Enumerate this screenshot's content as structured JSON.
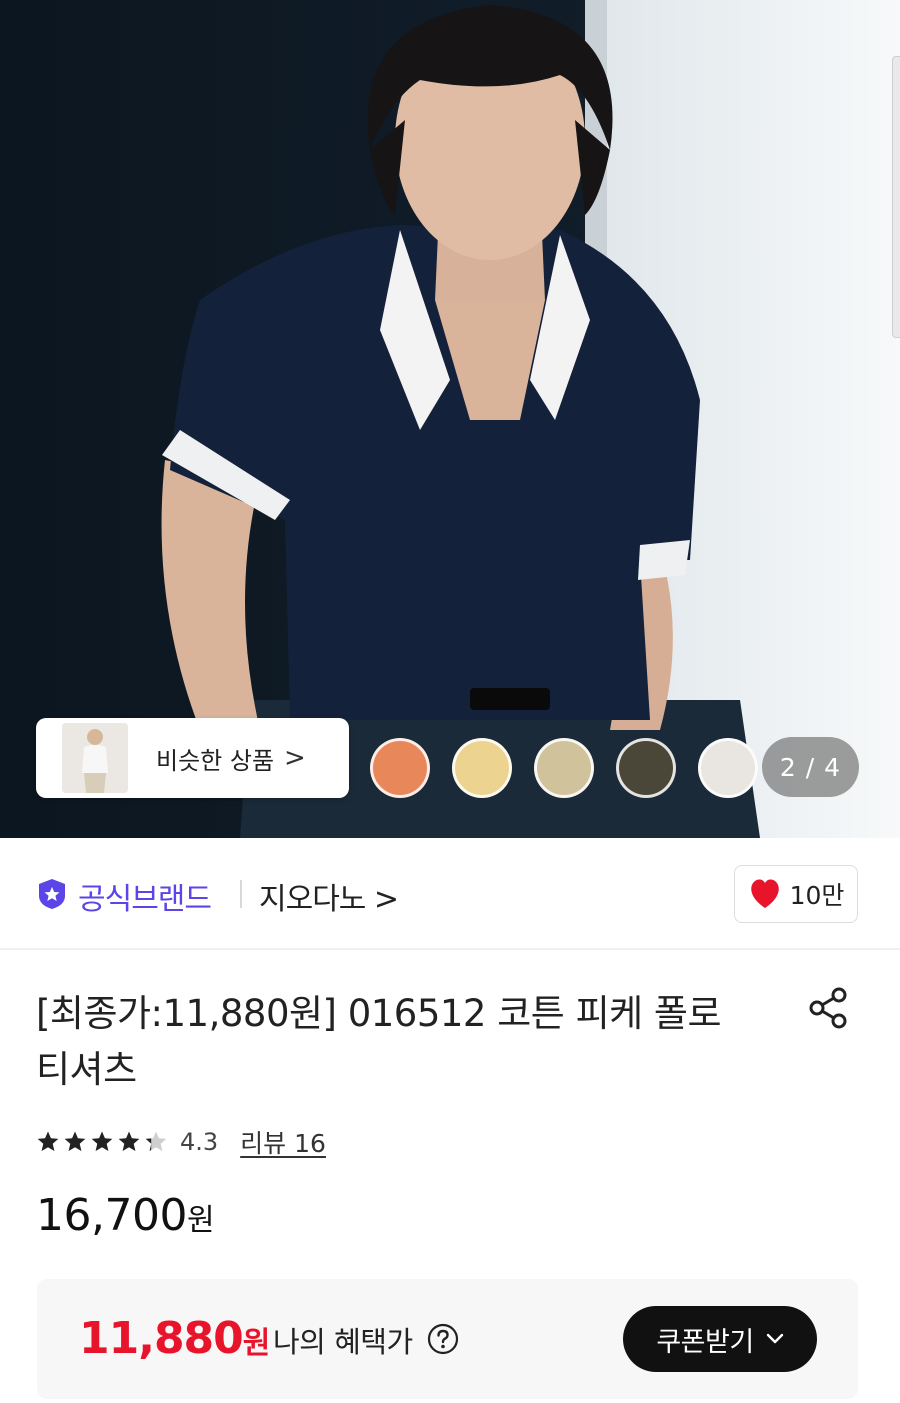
{
  "hero": {
    "similar_products_label": "비슷한 상품",
    "similar_products_chevron": ">",
    "swatch_colors": [
      "#e8875a",
      "#ecd38f",
      "#d0c39c",
      "#4a4638",
      "#e9e5e1"
    ],
    "page_counter": "2 / 4"
  },
  "brand": {
    "official_label": "공식브랜드",
    "name": "지오다노 >",
    "wishlist_count": "10만"
  },
  "product": {
    "title_line1": "[최종가:11,880원] 016512 코튼 피케 폴로",
    "title_line2": "티셔츠",
    "rating": {
      "value": "4.3",
      "stars_filled_fraction": 0.86,
      "review_link": "리뷰 16"
    },
    "price_number": "16,700",
    "price_unit": "원"
  },
  "benefit": {
    "price_number": "11,880",
    "price_unit": "원",
    "label": "나의 혜택가",
    "coupon_button": "쿠폰받기"
  },
  "colors": {
    "brand_purple": "#5b45e8",
    "benefit_red": "#e8142b",
    "heart_red": "#e8142b"
  }
}
